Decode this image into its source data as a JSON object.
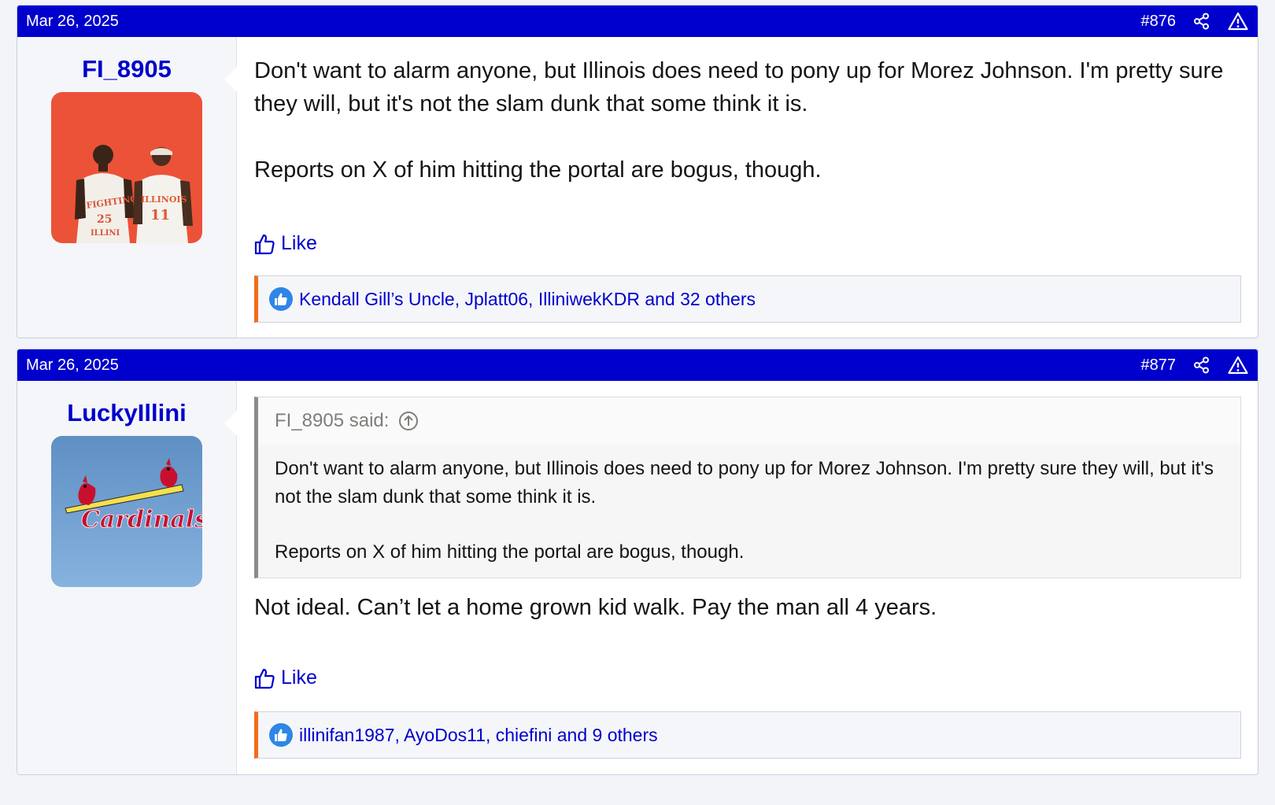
{
  "posts": [
    {
      "date": "Mar 26, 2025",
      "number": "#876",
      "username": "FI_8905",
      "avatar": "illini-basketball-players-avatar",
      "avatar_text": [
        "FIGHTING",
        "ILLINI",
        "25",
        "ILLINOIS",
        "11"
      ],
      "message": [
        "Don't want to alarm anyone, but Illinois does need to pony up for Morez Johnson. I'm pretty sure they will, but it's not the slam dunk that some think it is.",
        "Reports on X of him hitting the portal are bogus, though."
      ],
      "like_label": "Like",
      "reactions": "Kendall Gill’s Uncle, Jplatt06, IlliniwekKDR and 32 others"
    },
    {
      "date": "Mar 26, 2025",
      "number": "#877",
      "username": "LuckyIllini",
      "avatar": "cardinals-logo-avatar",
      "avatar_text": "Cardinals",
      "quote": {
        "author": "FI_8905 said:",
        "lines": [
          "Don't want to alarm anyone, but Illinois does need to pony up for Morez Johnson. I'm pretty sure they will, but it's not the slam dunk that some think it is.",
          "Reports on X of him hitting the portal are bogus, though."
        ]
      },
      "message": [
        "Not ideal. Can’t let a home grown kid walk. Pay the man all 4 years."
      ],
      "like_label": "Like",
      "reactions": "illinifan1987, AyoDos11, chiefini and 9 others"
    }
  ],
  "colors": {
    "header": "#0000cc",
    "link": "#0000cc",
    "reaction_accent": "#f36c1a",
    "like_reaction": "#2e86e6"
  },
  "icons": [
    "share-icon",
    "report-icon",
    "thumbs-up-icon",
    "like-reaction-icon",
    "quote-jump-icon"
  ]
}
